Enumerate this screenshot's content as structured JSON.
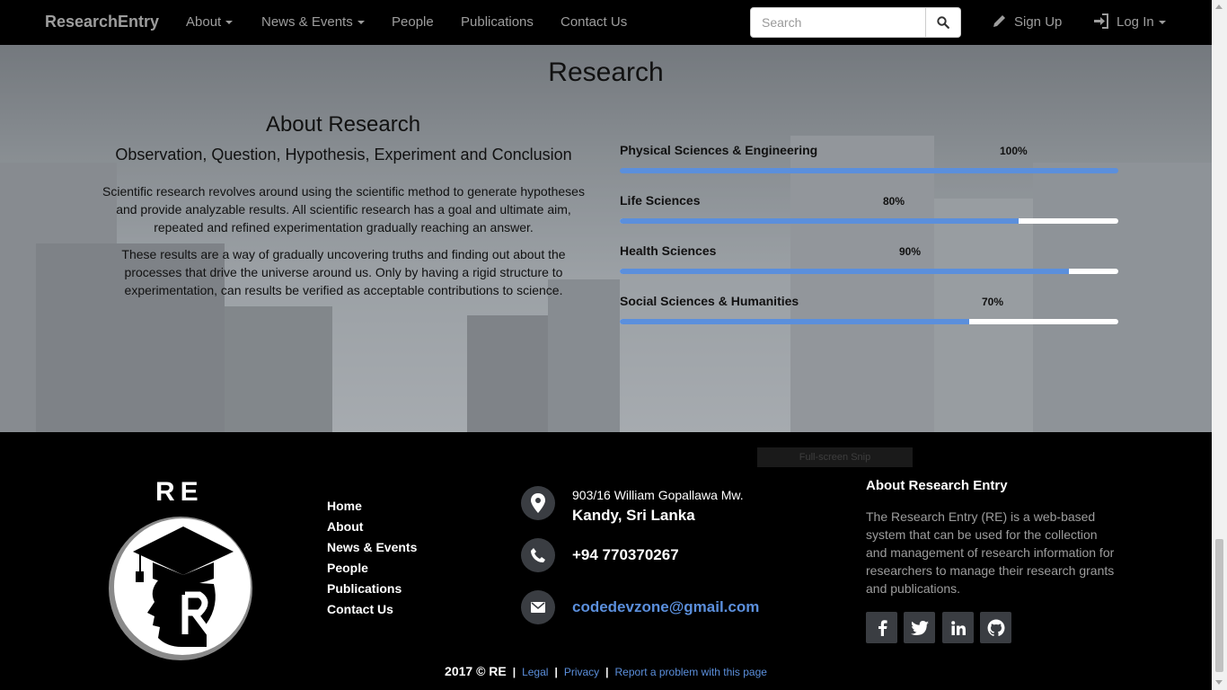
{
  "navbar": {
    "brand": "ResearchEntry",
    "links": [
      "About",
      "News & Events",
      "People",
      "Publications",
      "Contact Us"
    ],
    "search_placeholder": "Search",
    "signup": "Sign Up",
    "login": "Log In"
  },
  "hero": {
    "title": "Research",
    "about_heading": "About Research",
    "about_subheading": "Observation, Question, Hypothesis, Experiment and Conclusion",
    "paragraph1": "Scientific research revolves around using the scientific method to generate hypotheses and provide analyzable results. All scientific research has a goal and ultimate aim, repeated and refined experimentation gradually reaching an answer.",
    "paragraph2": "These results are a way of gradually uncovering truths and finding out about the processes that drive the universe around us. Only by having a rigid structure to experimentation, can results be verified as acceptable contributions to science.",
    "skills": [
      {
        "label": "Physical Sciences & Engineering",
        "percent_text": "100%",
        "value": 100
      },
      {
        "label": "Life Sciences",
        "percent_text": "80%",
        "value": 80
      },
      {
        "label": "Health Sciences",
        "percent_text": "90%",
        "value": 90
      },
      {
        "label": "Social Sciences & Humanities",
        "percent_text": "70%",
        "value": 70
      }
    ]
  },
  "footer": {
    "logo_text": "RE",
    "links": [
      "Home",
      "About",
      "News & Events",
      "People",
      "Publications",
      "Contact Us"
    ],
    "address_line1": "903/16 William Gopallawa Mw.",
    "address_line2": "Kandy, Sri Lanka",
    "phone": "+94 770370267",
    "email": "codedevzone@gmail.com",
    "about_heading": "About Research Entry",
    "about_text": "The Research Entry (RE) is a web-based system that can be used for the collection and management of research information for researchers to manage their research grants and publications.",
    "snip_label": "Full-screen Snip",
    "copyright": "2017 © RE",
    "legal": "Legal",
    "privacy": "Privacy",
    "report": "Report a problem with this page",
    "social_icons": [
      "facebook-icon",
      "twitter-icon",
      "linkedin-icon",
      "github-icon"
    ]
  },
  "colors": {
    "accent": "#5b8fdc",
    "navbar_bg": "#000000",
    "nav_text": "#9d9d9d",
    "icon_circle": "#3a3d42"
  }
}
